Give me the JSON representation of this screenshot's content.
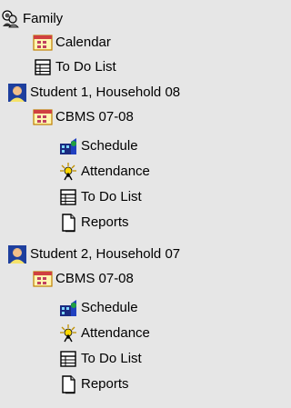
{
  "tree": {
    "family": {
      "label": "Family",
      "icon": "family-icon",
      "children": [
        {
          "label": "Calendar",
          "icon": "calendar-icon"
        },
        {
          "label": "To Do List",
          "icon": "todo-list-icon"
        }
      ]
    },
    "students": [
      {
        "label": "Student 1, Household 08",
        "icon": "student-icon",
        "course": {
          "label": "CBMS 07-08",
          "icon": "course-icon",
          "items": [
            {
              "label": "Schedule",
              "icon": "schedule-icon"
            },
            {
              "label": "Attendance",
              "icon": "attendance-icon"
            },
            {
              "label": "To Do List",
              "icon": "todo-list-icon"
            },
            {
              "label": "Reports",
              "icon": "reports-icon"
            }
          ]
        }
      },
      {
        "label": "Student 2, Household 07",
        "icon": "student-icon",
        "course": {
          "label": "CBMS 07-08",
          "icon": "course-icon",
          "items": [
            {
              "label": "Schedule",
              "icon": "schedule-icon"
            },
            {
              "label": "Attendance",
              "icon": "attendance-icon"
            },
            {
              "label": "To Do List",
              "icon": "todo-list-icon"
            },
            {
              "label": "Reports",
              "icon": "reports-icon"
            }
          ]
        }
      }
    ]
  }
}
